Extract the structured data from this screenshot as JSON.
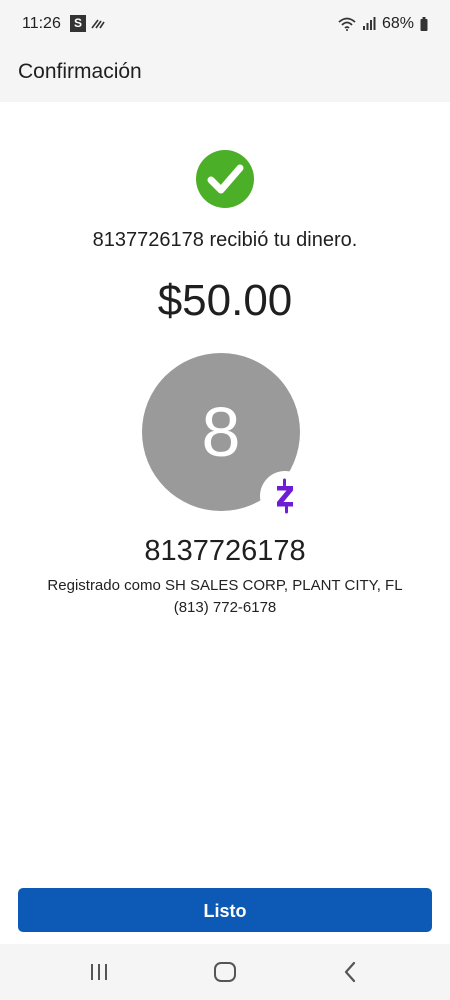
{
  "status_bar": {
    "time": "11:26",
    "s_badge": "S",
    "battery": "68%"
  },
  "header": {
    "title": "Confirmación"
  },
  "confirmation": {
    "message": "8137726178 recibió tu dinero.",
    "amount": "$50.00",
    "avatar_initial": "8",
    "recipient": "8137726178",
    "registered_as": "Registrado como SH SALES CORP, PLANT CITY, FL",
    "phone": "(813) 772-6178"
  },
  "actions": {
    "done_label": "Listo"
  },
  "colors": {
    "success_green": "#4caf28",
    "zelle_purple": "#6d1ed4",
    "primary_blue": "#0d5ab6",
    "avatar_gray": "#9a9a9a"
  }
}
